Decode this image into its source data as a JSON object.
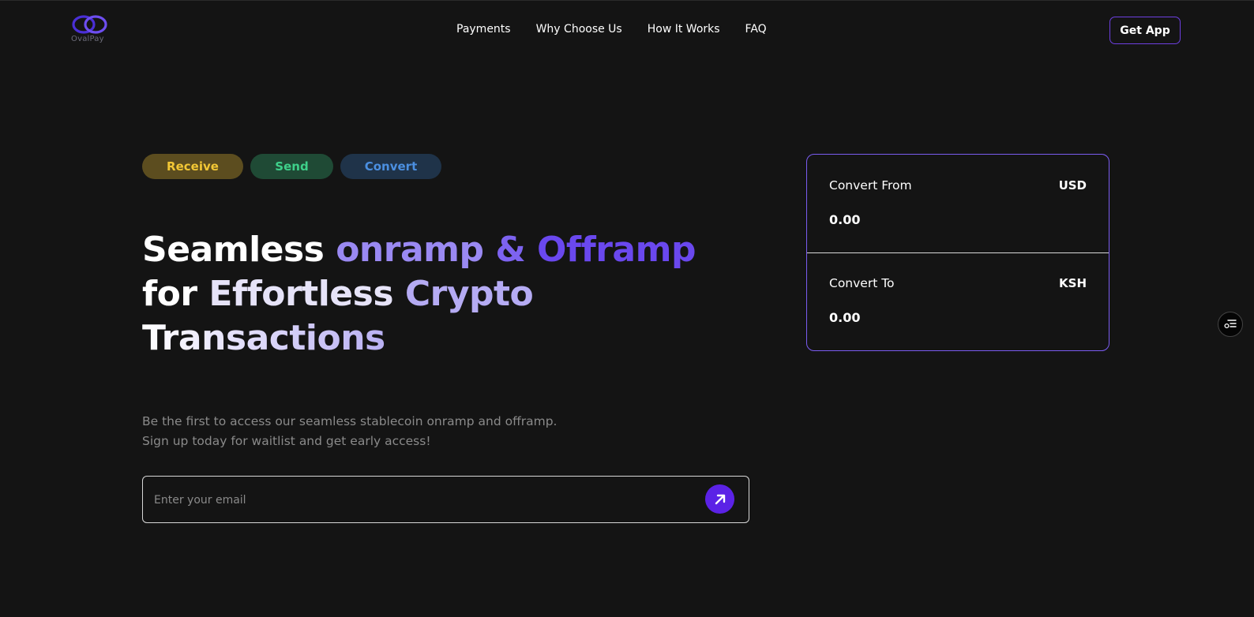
{
  "header": {
    "logo_text": "OvalPay",
    "nav": [
      "Payments",
      "Why Choose Us",
      "How It Works",
      "FAQ"
    ],
    "cta_label": "Get App"
  },
  "hero": {
    "pills": [
      "Receive",
      "Send",
      "Convert"
    ],
    "headline": [
      "Seamless",
      "onramp",
      "&",
      "Offramp",
      "for",
      "Effortless",
      "Crypto",
      "Transactions"
    ],
    "subtitle_line1": "Be the first to access our seamless stablecoin onramp and offramp.",
    "subtitle_line2": "Sign up today for waitlist and get early access!",
    "email_placeholder": "Enter your email"
  },
  "converter": {
    "from": {
      "label": "Convert From",
      "currency": "USD",
      "value": "0.00"
    },
    "to": {
      "label": "Convert To",
      "currency": "KSH",
      "value": "0.00"
    }
  },
  "icons": {
    "submit": "arrow-up-right-icon",
    "side": "list-settings-icon"
  },
  "colors": {
    "background": "#141414",
    "accent": "#5b22e6",
    "receive": "#f2c735",
    "send": "#3ed08a",
    "convert": "#4b8fe0"
  }
}
